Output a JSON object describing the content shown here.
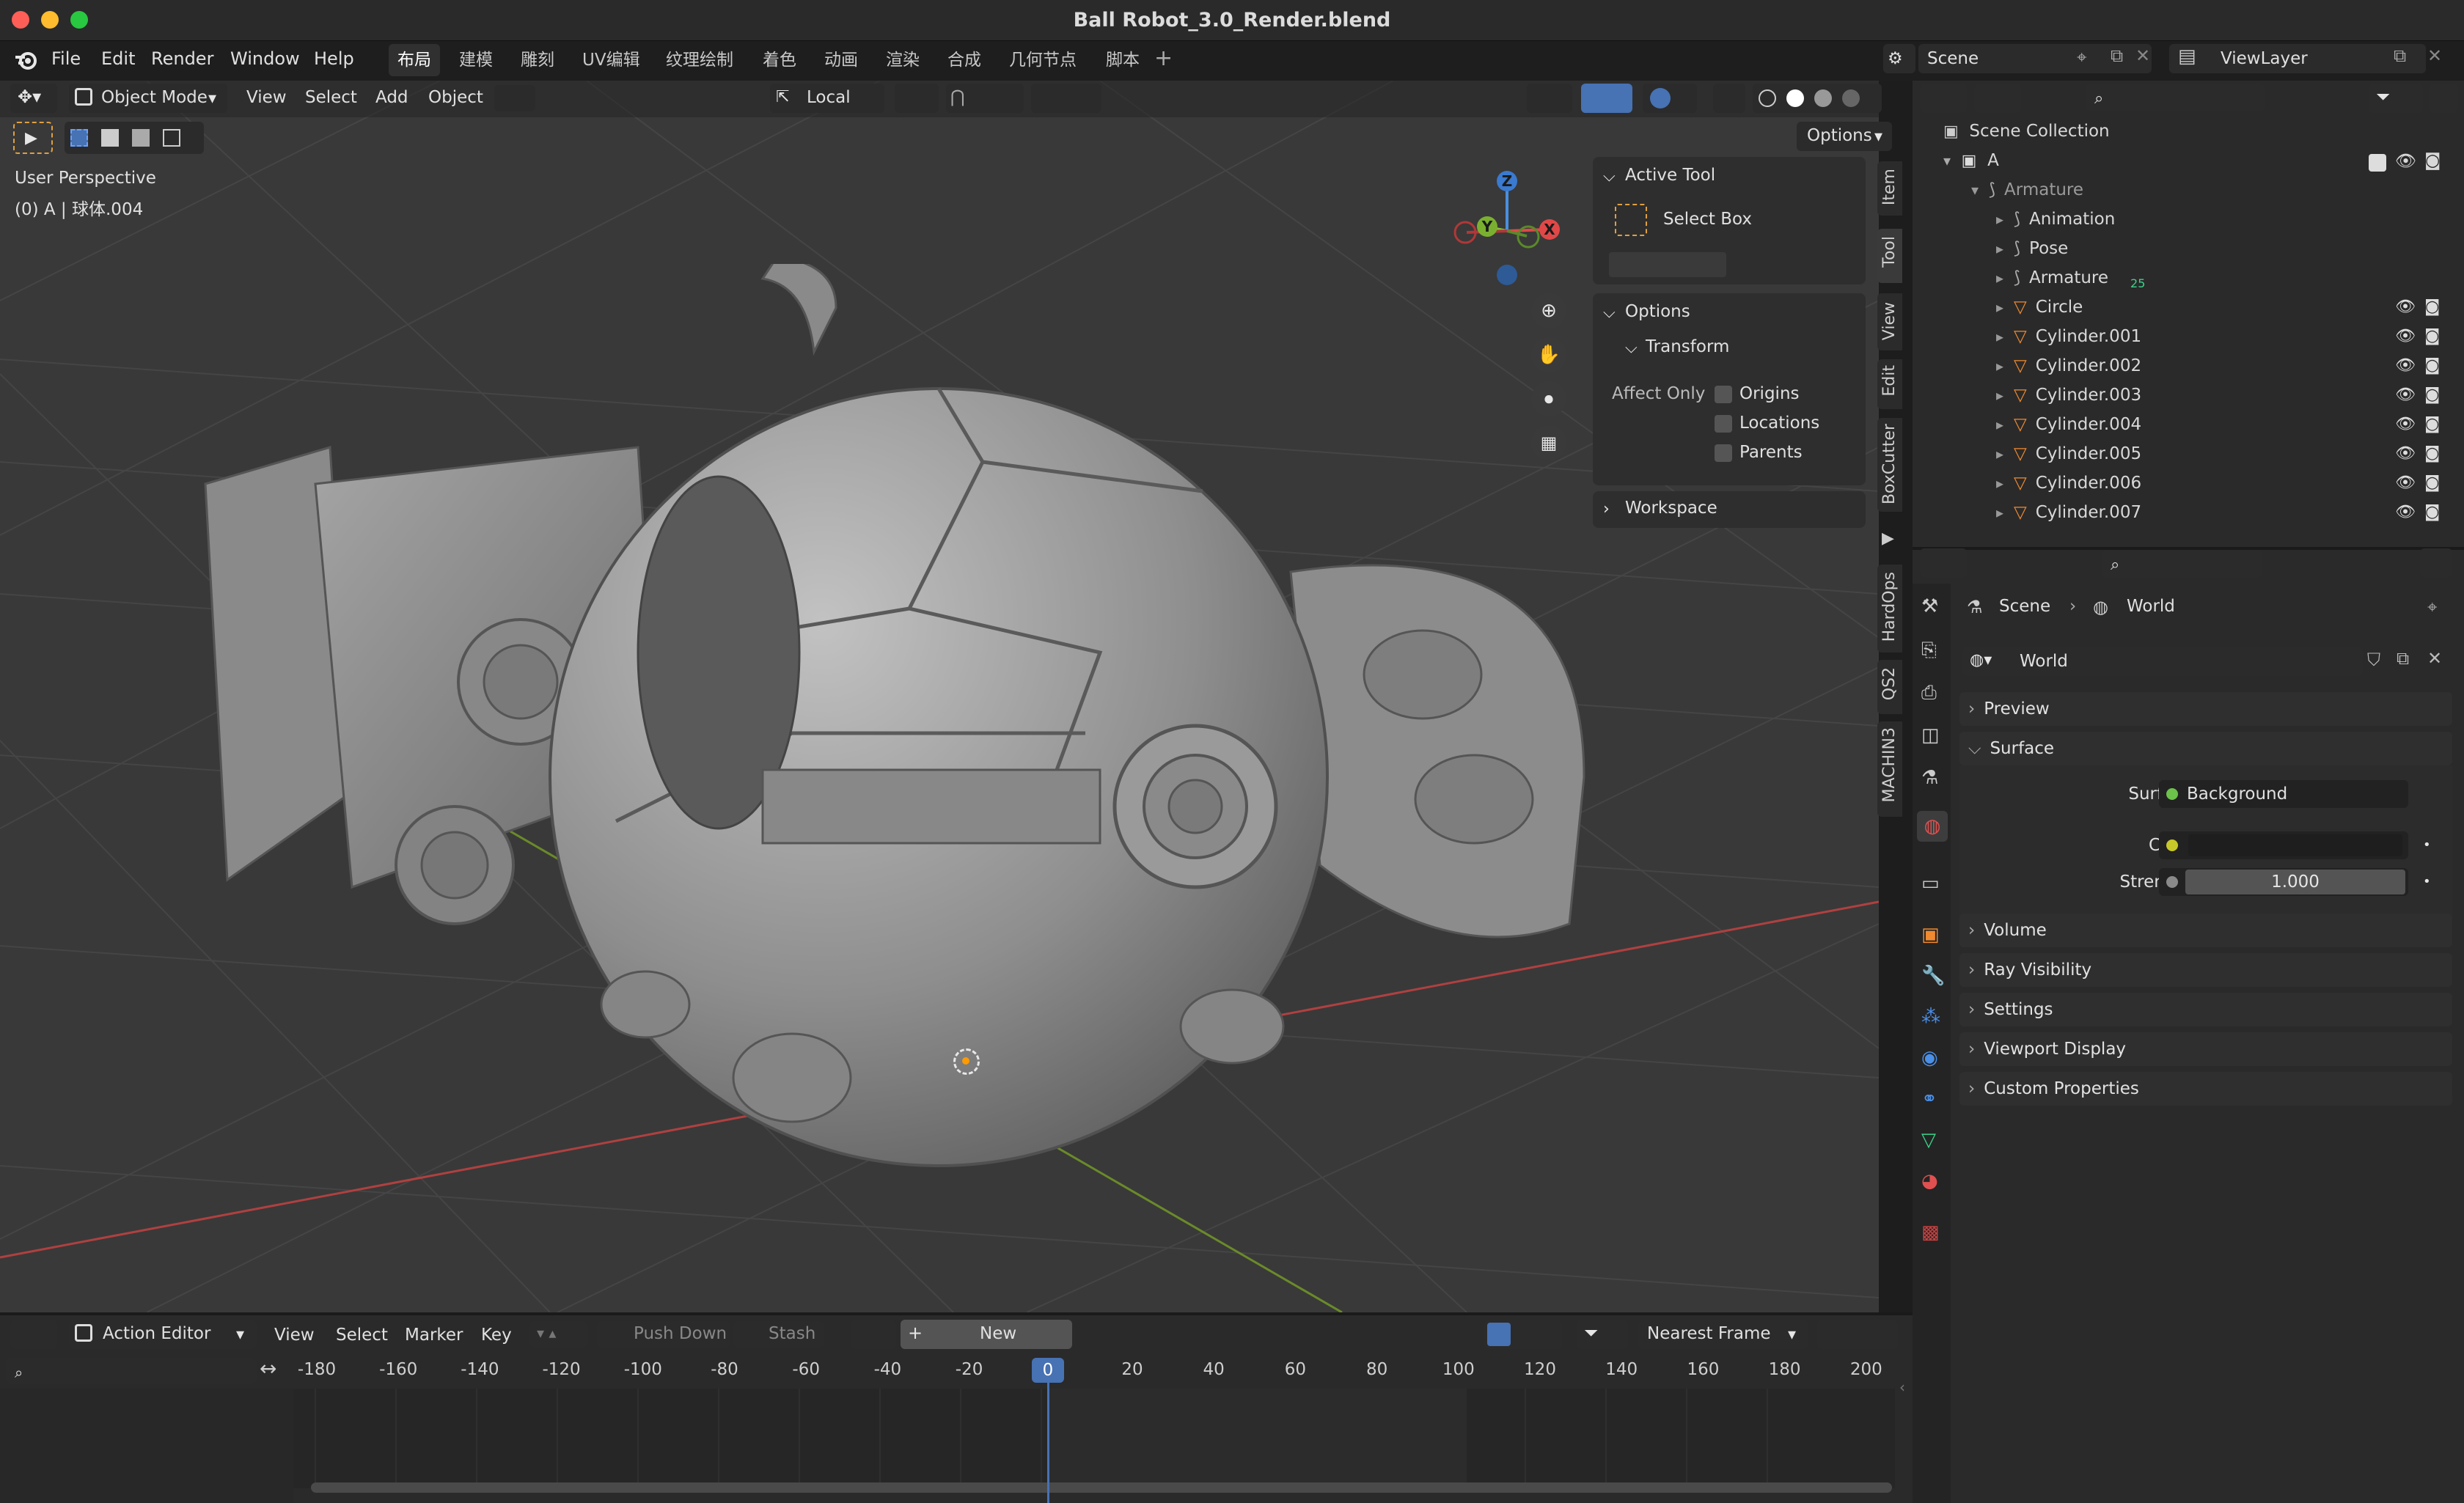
{
  "window": {
    "title": "Ball Robot_3.0_Render.blend"
  },
  "menu": [
    "File",
    "Edit",
    "Render",
    "Window",
    "Help"
  ],
  "workspaces": [
    "布局",
    "建模",
    "雕刻",
    "UV编辑",
    "纹理绘制",
    "着色",
    "动画",
    "渲染",
    "合成",
    "几何节点",
    "脚本"
  ],
  "scene_field": "Scene",
  "viewlayer_field": "ViewLayer",
  "viewport": {
    "mode": "Object Mode",
    "menus": [
      "View",
      "Select",
      "Add",
      "Object"
    ],
    "orientation": "Local",
    "options": "Options",
    "perspective": "User Perspective",
    "object_info": "(0) A | 球体.004"
  },
  "gizmo": {
    "z": "Z",
    "y": "Y",
    "x": "X"
  },
  "tool_panel": {
    "active_tool": "Active Tool",
    "select_box": "Select Box",
    "options": "Options",
    "transform": "Transform",
    "affect_only": "Affect Only",
    "origins": "Origins",
    "locations": "Locations",
    "parents": "Parents",
    "workspace": "Workspace"
  },
  "sidebar_tabs": [
    "Item",
    "Tool",
    "View",
    "Edit",
    "BoxCutter",
    "HardOps",
    "QS2",
    "MACHIN3"
  ],
  "outliner": {
    "root": "Scene Collection",
    "collection": "A",
    "items": [
      {
        "name": "Armature",
        "indent": 0,
        "dim": true
      },
      {
        "name": "Animation",
        "indent": 1
      },
      {
        "name": "Pose",
        "indent": 1
      },
      {
        "name": "Armature",
        "indent": 1,
        "badge": "25"
      },
      {
        "name": "Circle",
        "indent": 1,
        "eye": true
      },
      {
        "name": "Cylinder.001",
        "indent": 1,
        "eye": true
      },
      {
        "name": "Cylinder.002",
        "indent": 1,
        "eye": true
      },
      {
        "name": "Cylinder.003",
        "indent": 1,
        "eye": true
      },
      {
        "name": "Cylinder.004",
        "indent": 1,
        "eye": true
      },
      {
        "name": "Cylinder.005",
        "indent": 1,
        "eye": true
      },
      {
        "name": "Cylinder.006",
        "indent": 1,
        "eye": true
      },
      {
        "name": "Cylinder.007",
        "indent": 1,
        "eye": true
      }
    ]
  },
  "properties": {
    "breadcrumb_scene": "Scene",
    "breadcrumb_world": "World",
    "world_name": "World",
    "sections_top": [
      "Preview"
    ],
    "surface": "Surface",
    "surface_label": "Surface",
    "surface_value": "Background",
    "color_label": "Color",
    "strength_label": "Strength",
    "strength_value": "1.000",
    "sections_bottom": [
      "Volume",
      "Ray Visibility",
      "Settings",
      "Viewport Display",
      "Custom Properties"
    ]
  },
  "timeline": {
    "editor": "Action Editor",
    "menus": [
      "View",
      "Select",
      "Marker",
      "Key"
    ],
    "push_down": "Push Down",
    "stash": "Stash",
    "new": "New",
    "snap": "Nearest Frame",
    "current_frame": "0",
    "ticks": [
      "-180",
      "-160",
      "-140",
      "-120",
      "-100",
      "-80",
      "-60",
      "-40",
      "-20",
      "0",
      "20",
      "40",
      "60",
      "80",
      "100",
      "120",
      "140",
      "160",
      "180",
      "200"
    ]
  }
}
